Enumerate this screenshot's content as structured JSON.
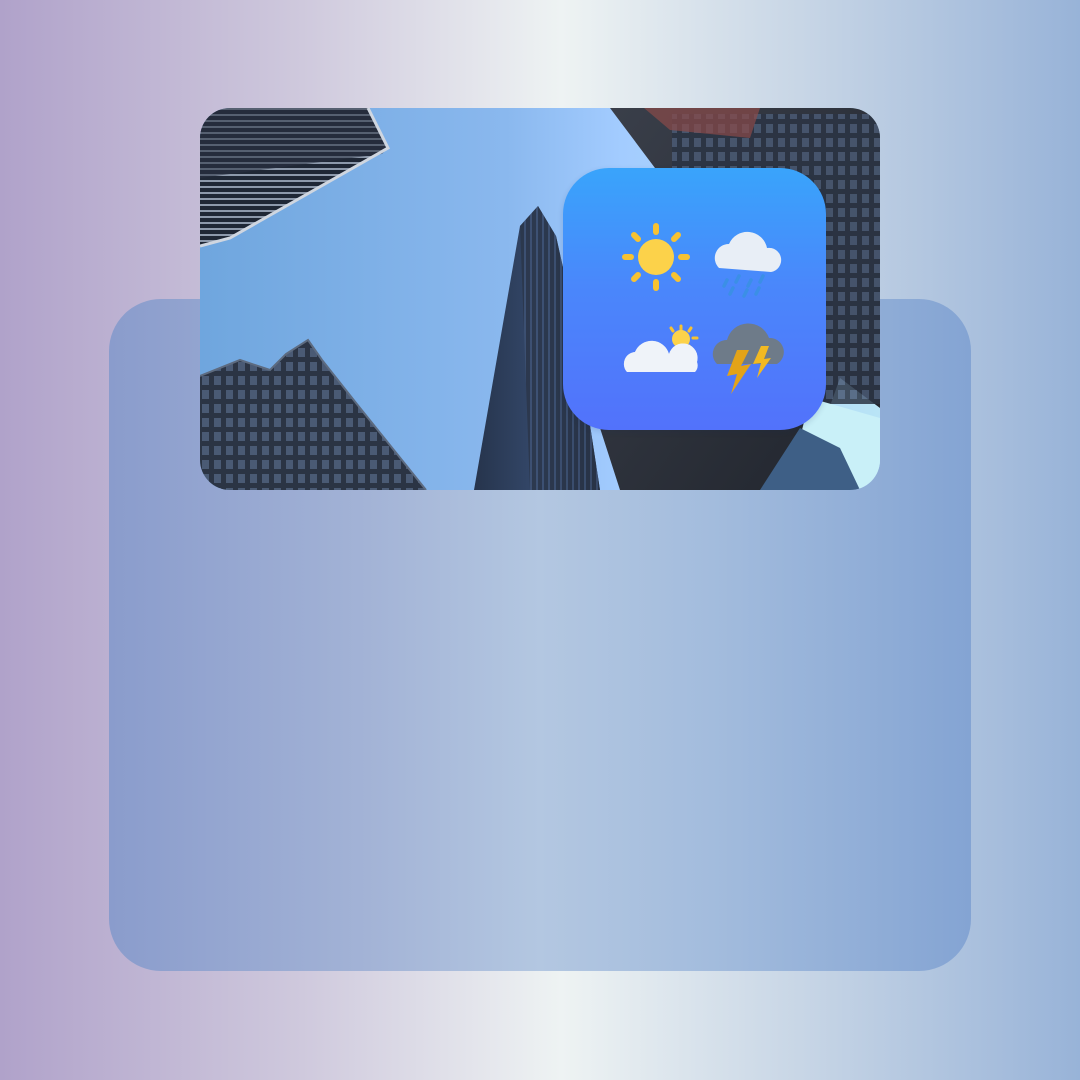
{
  "scene": {
    "photo": "city-skyscrapers-photo",
    "app_icon": "weather-app-icon"
  },
  "weather_icons": [
    {
      "name": "sun-icon"
    },
    {
      "name": "rain-cloud-icon"
    },
    {
      "name": "partly-cloudy-icon"
    },
    {
      "name": "thunderstorm-icon"
    }
  ],
  "colors": {
    "icon_gradient_top": "#39a4fb",
    "icon_gradient_bottom": "#5272fb",
    "sun": "#fcd24a",
    "sun_rays": "#f7c232",
    "cloud": "#e8eef6",
    "rain": "#3b8fe6",
    "storm_cloud": "#6e7b89",
    "lightning": "#e3a318"
  }
}
